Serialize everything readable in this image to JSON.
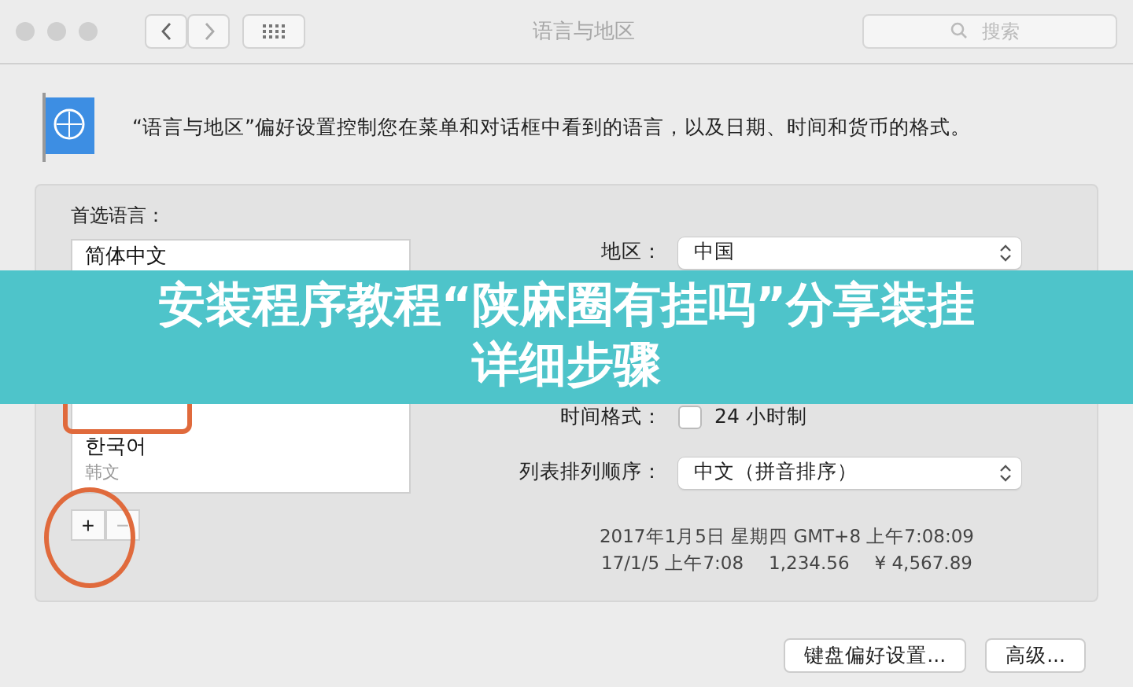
{
  "window": {
    "title": "语言与地区",
    "search": {
      "placeholder": "搜索"
    }
  },
  "description": "“语言与地区”偏好设置控制您在菜单和对话框中看到的语言，以及日期、时间和货币的格式。",
  "preferred_languages": {
    "label": "首选语言：",
    "items": [
      {
        "kind": "language",
        "name": "简体中文",
        "selected": false
      },
      {
        "kind": "covered"
      },
      {
        "kind": "language",
        "name": "한국어",
        "subtitle": "韩文",
        "selected": false
      }
    ],
    "buttons": [
      "+",
      "−"
    ]
  },
  "settings": [
    {
      "label": "地区：",
      "value": "中国",
      "kind": "popup"
    },
    {
      "kind": "covered"
    },
    {
      "kind": "covered"
    },
    {
      "label": "时间格式：",
      "value": "24 小时制",
      "kind": "checkbox",
      "checked": false
    },
    {
      "label": "列表排列顺序：",
      "value": "中文（拼音排序）",
      "kind": "popup"
    }
  ],
  "sample": [
    "2017年1月5日 星期四 GMT+8 上午7:08:09",
    "17/1/5 上午7:08",
    "1,234.56",
    "¥ 4,567.89"
  ],
  "buttons": [
    "键盘偏好设置...",
    "高级..."
  ],
  "banner": {
    "lines": [
      "安装程序教程“陕麻圈有挂吗”分享装挂",
      "详细步骤"
    ]
  }
}
